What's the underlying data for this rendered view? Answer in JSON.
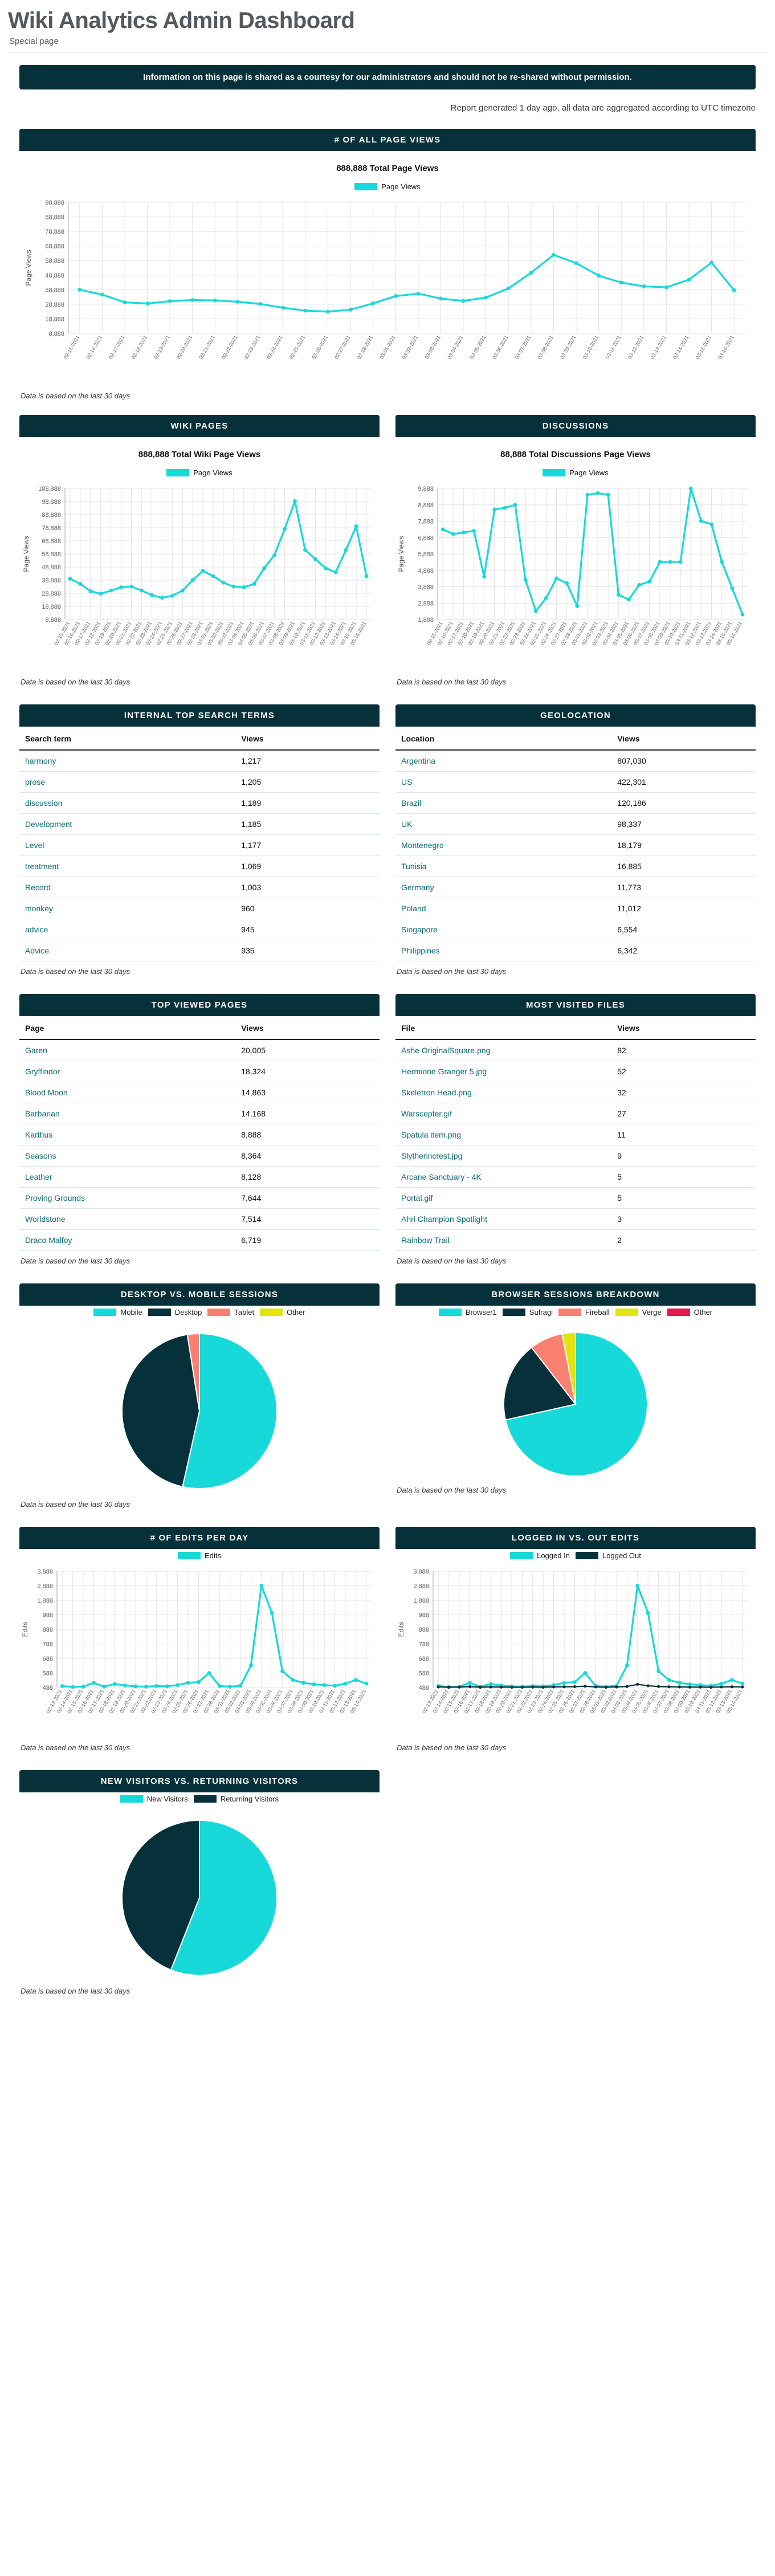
{
  "header": {
    "title": "Wiki Analytics Admin Dashboard",
    "subtitle": "Special page",
    "notice": "Information on this page is shared as a courtesy for our administrators and should not be re-shared without permission.",
    "report_line": "Report generated 1 day ago, all data are aggregated according to UTC timezone"
  },
  "footnote": "Data is based on the last 30 days",
  "colors": {
    "accent": "#17d9d9",
    "dark": "#06313a",
    "salmon": "#fa8072",
    "yellow": "#e3e30f",
    "crimson": "#e6194b",
    "link": "#0b6a74"
  },
  "all_page_views": {
    "title": "# OF ALL PAGE VIEWS",
    "total": "888,888 Total Page Views",
    "legend": [
      {
        "label": "Page Views",
        "color": "#17d9d9"
      }
    ],
    "ylabel": "Page Views"
  },
  "wiki_pages": {
    "title": "WIKI PAGES",
    "total": "888,888 Total Wiki Page Views",
    "legend": [
      {
        "label": "Page Views",
        "color": "#17d9d9"
      }
    ],
    "ylabel": "Page Views"
  },
  "discussions": {
    "title": "DISCUSSIONS",
    "total": "88,888 Total Discussions Page Views",
    "legend": [
      {
        "label": "Page Views",
        "color": "#17d9d9"
      }
    ],
    "ylabel": "Page Views"
  },
  "search_terms": {
    "title": "INTERNAL TOP SEARCH TERMS",
    "columns": [
      "Search term",
      "Views"
    ],
    "rows": [
      [
        "harmony",
        "1,217"
      ],
      [
        "prose",
        "1,205"
      ],
      [
        "discussion",
        "1,189"
      ],
      [
        "Development",
        "1,185"
      ],
      [
        "Level",
        "1,177"
      ],
      [
        "treatment",
        "1,069"
      ],
      [
        "Record",
        "1,003"
      ],
      [
        "monkey",
        "960"
      ],
      [
        "advice",
        "945"
      ],
      [
        "Advice",
        "935"
      ]
    ]
  },
  "geolocation": {
    "title": "GEOLOCATION",
    "columns": [
      "Location",
      "Views"
    ],
    "rows": [
      [
        "Argentina",
        "807,030"
      ],
      [
        "US",
        "422,301"
      ],
      [
        "Brazil",
        "120,186"
      ],
      [
        "UK",
        "98,337"
      ],
      [
        "Montenegro",
        "18,179"
      ],
      [
        "Tunisia",
        "16,885"
      ],
      [
        "Germany",
        "11,773"
      ],
      [
        "Poland",
        "11,012"
      ],
      [
        "Singapore",
        "6,554"
      ],
      [
        "Philippines",
        "6,342"
      ]
    ]
  },
  "top_pages": {
    "title": "TOP VIEWED PAGES",
    "columns": [
      "Page",
      "Views"
    ],
    "rows": [
      [
        "Garen",
        "20,005"
      ],
      [
        "Gryffindor",
        "18,324"
      ],
      [
        "Blood Moon",
        "14,863"
      ],
      [
        "Barbarian",
        "14,168"
      ],
      [
        "Karthus",
        "8,888"
      ],
      [
        "Seasons",
        "8,364"
      ],
      [
        "Leather",
        "8,128"
      ],
      [
        "Proving Grounds",
        "7,644"
      ],
      [
        "Worldstone",
        "7,514"
      ],
      [
        "Draco Malfoy",
        "6,719"
      ]
    ]
  },
  "most_files": {
    "title": "MOST VISITED FILES",
    "columns": [
      "File",
      "Views"
    ],
    "rows": [
      [
        "Ashe OriginalSquare.png",
        "82"
      ],
      [
        "Hermione Granger 5.jpg",
        "52"
      ],
      [
        "Skeletron Head.png",
        "32"
      ],
      [
        "Warscepter.gif",
        "27"
      ],
      [
        "Spatula item.png",
        "11"
      ],
      [
        "Slytherincrest.jpg",
        "9"
      ],
      [
        "Arcane Sanctuary - 4K",
        "5"
      ],
      [
        "Portal.gif",
        "5"
      ],
      [
        "Ahri Champion Spotlight",
        "3"
      ],
      [
        "Rainbow Trail",
        "2"
      ]
    ]
  },
  "desktop_mobile": {
    "title": "DESKTOP VS. MOBILE SESSIONS",
    "legend": [
      {
        "label": "Mobile",
        "color": "#17d9d9"
      },
      {
        "label": "Desktop",
        "color": "#06313a"
      },
      {
        "label": "Tablet",
        "color": "#fa8072"
      },
      {
        "label": "Other",
        "color": "#e3e30f"
      }
    ]
  },
  "browser_sessions": {
    "title": "BROWSER SESSIONS BREAKDOWN",
    "legend": [
      {
        "label": "Browser1",
        "color": "#17d9d9"
      },
      {
        "label": "Sufragi",
        "color": "#06313a"
      },
      {
        "label": "Fireball",
        "color": "#fa8072"
      },
      {
        "label": "Verge",
        "color": "#e3e30f"
      },
      {
        "label": "Other",
        "color": "#e6194b"
      }
    ]
  },
  "edits_per_day": {
    "title": "# OF EDITS PER DAY",
    "legend": [
      {
        "label": "Edits",
        "color": "#17d9d9"
      }
    ],
    "ylabel": "Edits"
  },
  "logged_edits": {
    "title": "LOGGED IN VS. OUT EDITS",
    "legend": [
      {
        "label": "Logged In",
        "color": "#17d9d9"
      },
      {
        "label": "Logged Out",
        "color": "#06313a"
      }
    ],
    "ylabel": "Edits"
  },
  "visitors": {
    "title": "NEW VISITORS VS. RETURNING VISITORS",
    "legend": [
      {
        "label": "New Visitors",
        "color": "#17d9d9"
      },
      {
        "label": "Returning Visitors",
        "color": "#06313a"
      }
    ]
  },
  "chart_data": [
    {
      "id": "all_page_views",
      "type": "line",
      "title": "# OF ALL PAGE VIEWS",
      "subtitle": "888,888 Total Page Views",
      "xlabel": "",
      "ylabel": "Page Views",
      "yticks": [
        8888,
        18888,
        28888,
        38888,
        48888,
        58888,
        68888,
        78888,
        88888,
        98888
      ],
      "ylim": [
        8888,
        98888
      ],
      "grid": true,
      "legend": [
        "Page Views"
      ],
      "legend_position": "top-center",
      "x": [
        "02-15-2021",
        "02-16-2021",
        "02-17-2021",
        "02-18-2021",
        "02-19-2021",
        "02-20-2021",
        "02-21-2021",
        "02-22-2021",
        "02-23-2021",
        "02-24-2021",
        "02-25-2021",
        "02-26-2021",
        "02-27-2021",
        "02-28-2021",
        "03-01-2021",
        "03-02-2021",
        "03-03-2021",
        "03-04-2021",
        "03-05-2021",
        "03-06-2021",
        "03-07-2021",
        "03-08-2021",
        "03-09-2021",
        "03-10-2021",
        "03-11-2021",
        "03-12-2021",
        "03-13-2021",
        "03-14-2021",
        "03-15-2021",
        "03-16-2021"
      ],
      "series": [
        {
          "name": "Page Views",
          "color": "#17d9d9",
          "values": [
            38888,
            35500,
            30200,
            29400,
            31000,
            31800,
            31500,
            30600,
            29100,
            26500,
            24500,
            23800,
            25200,
            29500,
            34500,
            36200,
            32800,
            31200,
            33500,
            39800,
            50500,
            62800,
            57200,
            48500,
            43800,
            41200,
            40500,
            45800,
            57500,
            38500
          ]
        }
      ]
    },
    {
      "id": "wiki_pages",
      "type": "line",
      "title": "WIKI PAGES",
      "subtitle": "888,888 Total Wiki Page Views",
      "xlabel": "",
      "ylabel": "Page Views",
      "yticks": [
        8888,
        18888,
        28888,
        38888,
        48888,
        58888,
        68888,
        78888,
        88888,
        98888,
        188888
      ],
      "ylim": [
        8888,
        188888
      ],
      "grid": true,
      "legend": [
        "Page Views"
      ],
      "legend_position": "top-center",
      "x": [
        "02-15-2021",
        "02-16-2021",
        "02-17-2021",
        "02-18-2021",
        "02-19-2021",
        "02-20-2021",
        "02-21-2021",
        "02-22-2021",
        "02-23-2021",
        "02-24-2021",
        "02-25-2021",
        "02-26-2021",
        "02-27-2021",
        "02-28-2021",
        "03-01-2021",
        "03-02-2021",
        "03-03-2021",
        "03-04-2021",
        "03-05-2021",
        "03-06-2021",
        "03-07-2021",
        "03-08-2021",
        "03-09-2021",
        "03-10-2021",
        "03-11-2021",
        "03-12-2021",
        "03-13-2021",
        "03-14-2021",
        "03-15-2021",
        "03-16-2021"
      ],
      "series": [
        {
          "name": "Page Views",
          "color": "#17d9d9",
          "values": [
            40000,
            36000,
            30500,
            28500,
            31000,
            33500,
            34000,
            31000,
            27500,
            25500,
            27000,
            31000,
            39000,
            46000,
            42000,
            37000,
            34000,
            33500,
            36000,
            48000,
            58000,
            78000,
            101000,
            62000,
            55000,
            48000,
            45000,
            62000,
            80000,
            42000
          ]
        }
      ]
    },
    {
      "id": "discussions",
      "type": "line",
      "title": "DISCUSSIONS",
      "subtitle": "88,888 Total Discussions Page Views",
      "xlabel": "",
      "ylabel": "Page Views",
      "yticks": [
        1888,
        2888,
        3888,
        4888,
        5888,
        6888,
        7888,
        8888,
        9888
      ],
      "ylim": [
        1888,
        9888
      ],
      "grid": true,
      "legend": [
        "Page Views"
      ],
      "legend_position": "top-center",
      "x": [
        "02-15-2021",
        "02-16-2021",
        "02-17-2021",
        "02-18-2021",
        "02-19-2021",
        "02-20-2021",
        "02-21-2021",
        "02-22-2021",
        "02-23-2021",
        "02-24-2021",
        "02-25-2021",
        "02-26-2021",
        "02-27-2021",
        "02-28-2021",
        "03-01-2021",
        "03-02-2021",
        "03-03-2021",
        "03-04-2021",
        "03-05-2021",
        "03-06-2021",
        "03-07-2021",
        "03-08-2021",
        "03-09-2021",
        "03-10-2021",
        "03-11-2021",
        "03-12-2021",
        "03-13-2021",
        "03-14-2021",
        "03-15-2021",
        "03-16-2021"
      ],
      "series": [
        {
          "name": "Page Views",
          "color": "#17d9d9",
          "values": [
            7388,
            7100,
            7200,
            7300,
            4500,
            8600,
            8700,
            8888,
            4300,
            2400,
            3200,
            4400,
            4100,
            2700,
            9500,
            9600,
            9500,
            3400,
            3100,
            4000,
            4200,
            5400,
            5400,
            5400,
            9950,
            7900,
            7700,
            5400,
            3800,
            2200
          ]
        }
      ]
    },
    {
      "id": "desktop_vs_mobile",
      "type": "pie",
      "title": "DESKTOP VS. MOBILE SESSIONS",
      "legend": [
        "Mobile",
        "Desktop",
        "Tablet",
        "Other"
      ],
      "legend_position": "top-center",
      "labels": [
        "Mobile",
        "Desktop",
        "Tablet",
        "Other"
      ],
      "values": [
        53.5,
        44.0,
        2.5,
        0.0
      ],
      "colors": [
        "#17d9d9",
        "#06313a",
        "#fa8072",
        "#e3e30f"
      ]
    },
    {
      "id": "browser_sessions",
      "type": "pie",
      "title": "BROWSER SESSIONS BREAKDOWN",
      "legend": [
        "Browser1",
        "Sufragi",
        "Fireball",
        "Verge",
        "Other"
      ],
      "legend_position": "top-center",
      "labels": [
        "Browser1",
        "Sufragi",
        "Fireball",
        "Verge",
        "Other"
      ],
      "values": [
        71.5,
        18.0,
        7.5,
        3.0,
        0.0
      ],
      "colors": [
        "#17d9d9",
        "#06313a",
        "#fa8072",
        "#e3e30f",
        "#e6194b"
      ]
    },
    {
      "id": "edits_per_day",
      "type": "line",
      "title": "# OF EDITS PER DAY",
      "xlabel": "",
      "ylabel": "Edits",
      "yticks": [
        488,
        588,
        688,
        788,
        888,
        988,
        1888,
        2888,
        3888
      ],
      "ylim": [
        488,
        3888
      ],
      "grid": true,
      "legend": [
        "Edits"
      ],
      "legend_position": "top-center",
      "x": [
        "02-13-2021",
        "02-14-2021",
        "02-15-2021",
        "02-16-2021",
        "02-17-2021",
        "02-18-2021",
        "02-19-2021",
        "02-20-2021",
        "02-21-2021",
        "02-22-2021",
        "02-23-2021",
        "02-24-2021",
        "02-25-2021",
        "02-26-2021",
        "02-27-2021",
        "02-28-2021",
        "03-01-2021",
        "03-02-2021",
        "03-03-2021",
        "03-04-2021",
        "03-05-2021",
        "03-06-2021",
        "03-07-2021",
        "03-08-2021",
        "03-09-2021",
        "03-10-2021",
        "03-11-2021",
        "03-12-2021",
        "03-13-2021",
        "03-14-2021"
      ],
      "series": [
        {
          "name": "Edits",
          "color": "#17d9d9",
          "values": [
            498,
            492,
            494,
            520,
            494,
            512,
            502,
            496,
            494,
            498,
            496,
            505,
            520,
            525,
            588,
            498,
            494,
            500,
            640,
            2888,
            1100,
            600,
            540,
            520,
            510,
            505,
            500,
            515,
            540,
            515
          ]
        }
      ]
    },
    {
      "id": "logged_in_vs_out",
      "type": "line",
      "title": "LOGGED IN VS. OUT EDITS",
      "xlabel": "",
      "ylabel": "Edits",
      "yticks": [
        488,
        588,
        688,
        788,
        888,
        988,
        1888,
        2888,
        3888
      ],
      "ylim": [
        488,
        3888
      ],
      "grid": true,
      "legend": [
        "Logged In",
        "Logged Out"
      ],
      "legend_position": "top-center",
      "x": [
        "02-13-2021",
        "02-14-2021",
        "02-15-2021",
        "02-16-2021",
        "02-17-2021",
        "02-18-2021",
        "02-19-2021",
        "02-20-2021",
        "02-21-2021",
        "02-22-2021",
        "02-23-2021",
        "02-24-2021",
        "02-25-2021",
        "02-26-2021",
        "02-27-2021",
        "02-28-2021",
        "03-01-2021",
        "03-02-2021",
        "03-03-2021",
        "03-04-2021",
        "03-05-2021",
        "03-06-2021",
        "03-07-2021",
        "03-08-2021",
        "03-09-2021",
        "03-10-2021",
        "03-11-2021",
        "03-12-2021",
        "03-13-2021",
        "03-14-2021"
      ],
      "series": [
        {
          "name": "Logged In",
          "color": "#17d9d9",
          "values": [
            498,
            492,
            494,
            520,
            494,
            512,
            502,
            496,
            494,
            498,
            496,
            505,
            520,
            525,
            588,
            498,
            494,
            500,
            640,
            2888,
            1100,
            600,
            540,
            520,
            510,
            505,
            500,
            515,
            540,
            515
          ]
        },
        {
          "name": "Logged Out",
          "color": "#06313a",
          "values": [
            492,
            490,
            491,
            494,
            490,
            492,
            491,
            490,
            490,
            491,
            490,
            492,
            493,
            494,
            497,
            492,
            490,
            492,
            495,
            510,
            500,
            495,
            493,
            492,
            491,
            491,
            490,
            492,
            493,
            492
          ]
        }
      ]
    },
    {
      "id": "new_vs_returning_visitors",
      "type": "pie",
      "title": "NEW VISITORS VS. RETURNING VISITORS",
      "legend": [
        "New Visitors",
        "Returning Visitors"
      ],
      "legend_position": "top-center",
      "labels": [
        "New Visitors",
        "Returning Visitors"
      ],
      "values": [
        56.0,
        44.0
      ],
      "colors": [
        "#17d9d9",
        "#06313a"
      ]
    }
  ]
}
